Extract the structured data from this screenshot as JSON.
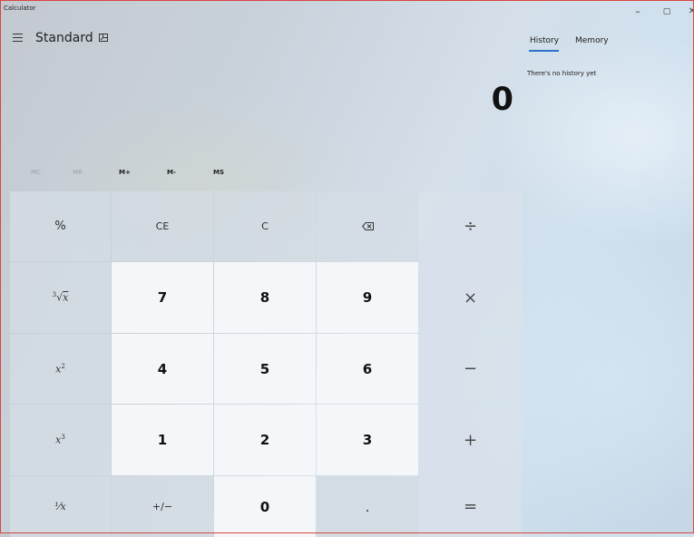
{
  "window": {
    "title": "Calculator",
    "minimize": "–",
    "maximize": "▢",
    "close": "✕"
  },
  "header": {
    "mode": "Standard",
    "icons": [
      "hamburger-menu-icon",
      "keep-on-top-icon"
    ]
  },
  "display": {
    "value": "0"
  },
  "memory_bar": {
    "buttons": [
      {
        "label": "MC",
        "enabled": false
      },
      {
        "label": "MR",
        "enabled": false
      },
      {
        "label": "M+",
        "enabled": true
      },
      {
        "label": "M-",
        "enabled": true
      },
      {
        "label": "MS",
        "enabled": true
      }
    ]
  },
  "side_panel": {
    "tabs": [
      {
        "label": "History",
        "active": true
      },
      {
        "label": "Memory",
        "active": false
      }
    ],
    "history_empty": "There's no history yet"
  },
  "keypad": {
    "percent": "%",
    "clear_entry": "CE",
    "clear": "C",
    "backspace_icon": "backspace-icon",
    "divide": "÷",
    "cube_root_index": "3",
    "cube_root_var": "x",
    "seven": "7",
    "eight": "8",
    "nine": "9",
    "multiply": "×",
    "square_var": "x",
    "square_exp": "2",
    "four": "4",
    "five": "5",
    "six": "6",
    "subtract": "−",
    "cube_var": "x",
    "cube_exp": "3",
    "one": "1",
    "two": "2",
    "three": "3",
    "add": "+",
    "reciprocal": "⅟x",
    "negate": "+∕−",
    "zero": "0",
    "decimal": ".",
    "equals": "="
  }
}
